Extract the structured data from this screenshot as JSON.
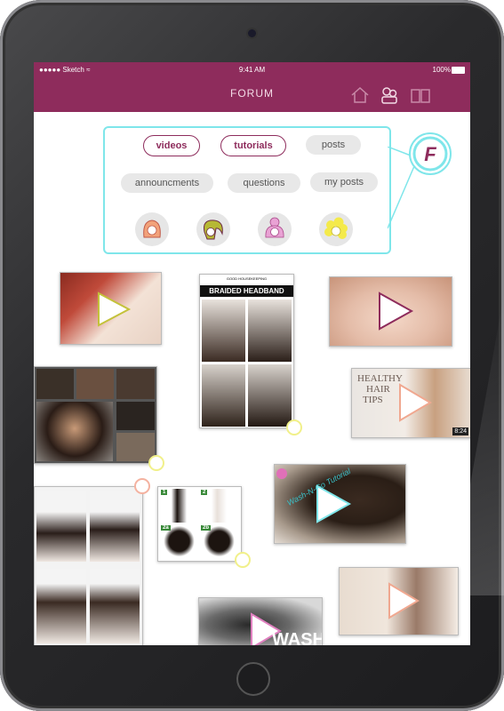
{
  "status": {
    "carrier": "Sketch",
    "time": "9:41 AM",
    "battery": "100%"
  },
  "nav": {
    "title": "FORUM",
    "icons": [
      "home-icon",
      "community-icon",
      "book-icon"
    ]
  },
  "filters": {
    "row1": [
      {
        "label": "videos",
        "active": true
      },
      {
        "label": "tutorials",
        "active": true
      },
      {
        "label": "posts",
        "active": false
      }
    ],
    "row2": [
      {
        "label": "announcments",
        "active": false
      },
      {
        "label": "questions",
        "active": false
      },
      {
        "label": "my posts",
        "active": false
      }
    ],
    "avatars": [
      "orange-hair-avatar",
      "green-hair-avatar",
      "pink-hair-avatar",
      "yellow-hair-avatar"
    ]
  },
  "logo": {
    "letter": "F"
  },
  "thumbnails": {
    "braided_headband": {
      "brand": "GOOD HOUSEKEEPING",
      "title": "BRAIDED HEADBAND"
    },
    "healthy_hair": {
      "title_line1": "HEALTHY",
      "title_line2": "HAIR",
      "title_line3": "TIPS",
      "duration": "8:24"
    },
    "wash_go": {
      "title": "Wash-N-Go Tutorial"
    },
    "steps": [
      "1",
      "2",
      "2a",
      "2b"
    ],
    "wash": {
      "text": "WASH"
    }
  },
  "colors": {
    "brand": "#8e2c5c",
    "accent": "#7fe6ea",
    "ring": "#f1f08a"
  }
}
